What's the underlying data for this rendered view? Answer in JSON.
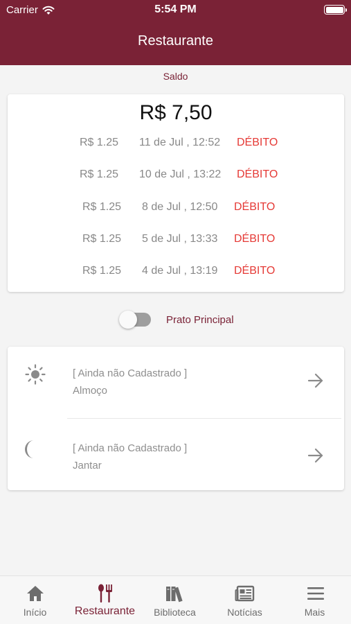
{
  "status_bar": {
    "carrier": "Carrier",
    "time": "5:54 PM"
  },
  "header": {
    "title": "Restaurante"
  },
  "balance": {
    "label": "Saldo",
    "amount": "R$ 7,50",
    "transactions": [
      {
        "value": "R$ 1.25",
        "date": "11 de Jul , 12:52",
        "type": "DÉBITO"
      },
      {
        "value": "R$ 1.25",
        "date": "10 de Jul , 13:22",
        "type": "DÉBITO"
      },
      {
        "value": "R$ 1.25",
        "date": "8 de Jul , 12:50",
        "type": "DÉBITO"
      },
      {
        "value": "R$ 1.25",
        "date": "5 de Jul , 13:33",
        "type": "DÉBITO"
      },
      {
        "value": "R$ 1.25",
        "date": "4 de Jul , 13:19",
        "type": "DÉBITO"
      }
    ]
  },
  "toggle": {
    "label": "Prato Principal",
    "enabled": false
  },
  "meals": [
    {
      "status": "[ Ainda não Cadastrado ]",
      "name": "Almoço",
      "icon": "sun-icon"
    },
    {
      "status": "[ Ainda não Cadastrado ]",
      "name": "Jantar",
      "icon": "moon-icon"
    }
  ],
  "tab_bar": {
    "tabs": [
      {
        "label": "Início",
        "icon": "home-icon"
      },
      {
        "label": "Restaurante",
        "icon": "cutlery-icon",
        "active": true
      },
      {
        "label": "Biblioteca",
        "icon": "books-icon"
      },
      {
        "label": "Notícias",
        "icon": "newspaper-icon"
      },
      {
        "label": "Mais",
        "icon": "menu-icon"
      }
    ]
  },
  "colors": {
    "brand": "#7a2236",
    "debit": "#e53935",
    "muted": "#888888"
  }
}
